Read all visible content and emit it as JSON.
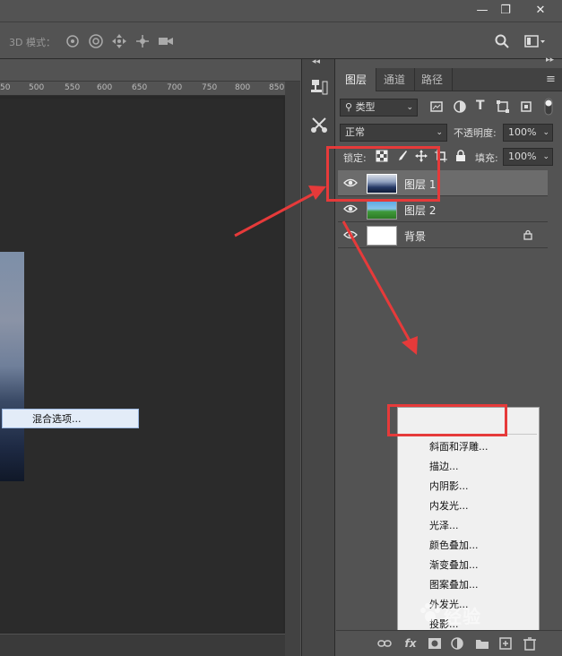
{
  "window": {
    "minimize_glyph": "—",
    "restore_glyph": "❐",
    "close_glyph": "✕"
  },
  "options_bar": {
    "mode_label": "3D 模式：",
    "icons": [
      "orbit-3d-icon",
      "roll-3d-icon",
      "pan-3d-icon",
      "slide-3d-icon",
      "video-camera-icon"
    ]
  },
  "ruler": {
    "ticks": [
      "50",
      "500",
      "550",
      "600",
      "650",
      "700",
      "750",
      "800",
      "850"
    ]
  },
  "tool_strip": {
    "collapse_glyph": "◂◂",
    "icons": [
      "clone-source-icon",
      "tool-preset-icon"
    ]
  },
  "layers_panel": {
    "collapse_glyph": "▸▸",
    "tabs": [
      {
        "label": "图层",
        "active": true
      },
      {
        "label": "通道",
        "active": false
      },
      {
        "label": "路径",
        "active": false
      }
    ],
    "menu_glyph": "≡",
    "filter_kind": "类型",
    "blend_mode": "正常",
    "opacity_label": "不透明度:",
    "opacity_value": "100%",
    "lock_label": "锁定:",
    "fill_label": "填充:",
    "fill_value": "100%",
    "layers": [
      {
        "name": "图层 1",
        "selected": true
      },
      {
        "name": "图层 2",
        "selected": false
      },
      {
        "name": "背景",
        "selected": false,
        "locked": true
      }
    ]
  },
  "context_menu": {
    "items": [
      "混合选项...",
      "斜面和浮雕...",
      "描边...",
      "内阴影...",
      "内发光...",
      "光泽...",
      "颜色叠加...",
      "渐变叠加...",
      "图案叠加...",
      "外发光...",
      "投影..."
    ]
  },
  "footer": {
    "fx_label": "fx"
  },
  "watermark": {
    "text": "经验"
  },
  "colors": {
    "annotation_red": "#e63a3a",
    "panel_bg": "#535353",
    "canvas_bg": "#282828"
  }
}
